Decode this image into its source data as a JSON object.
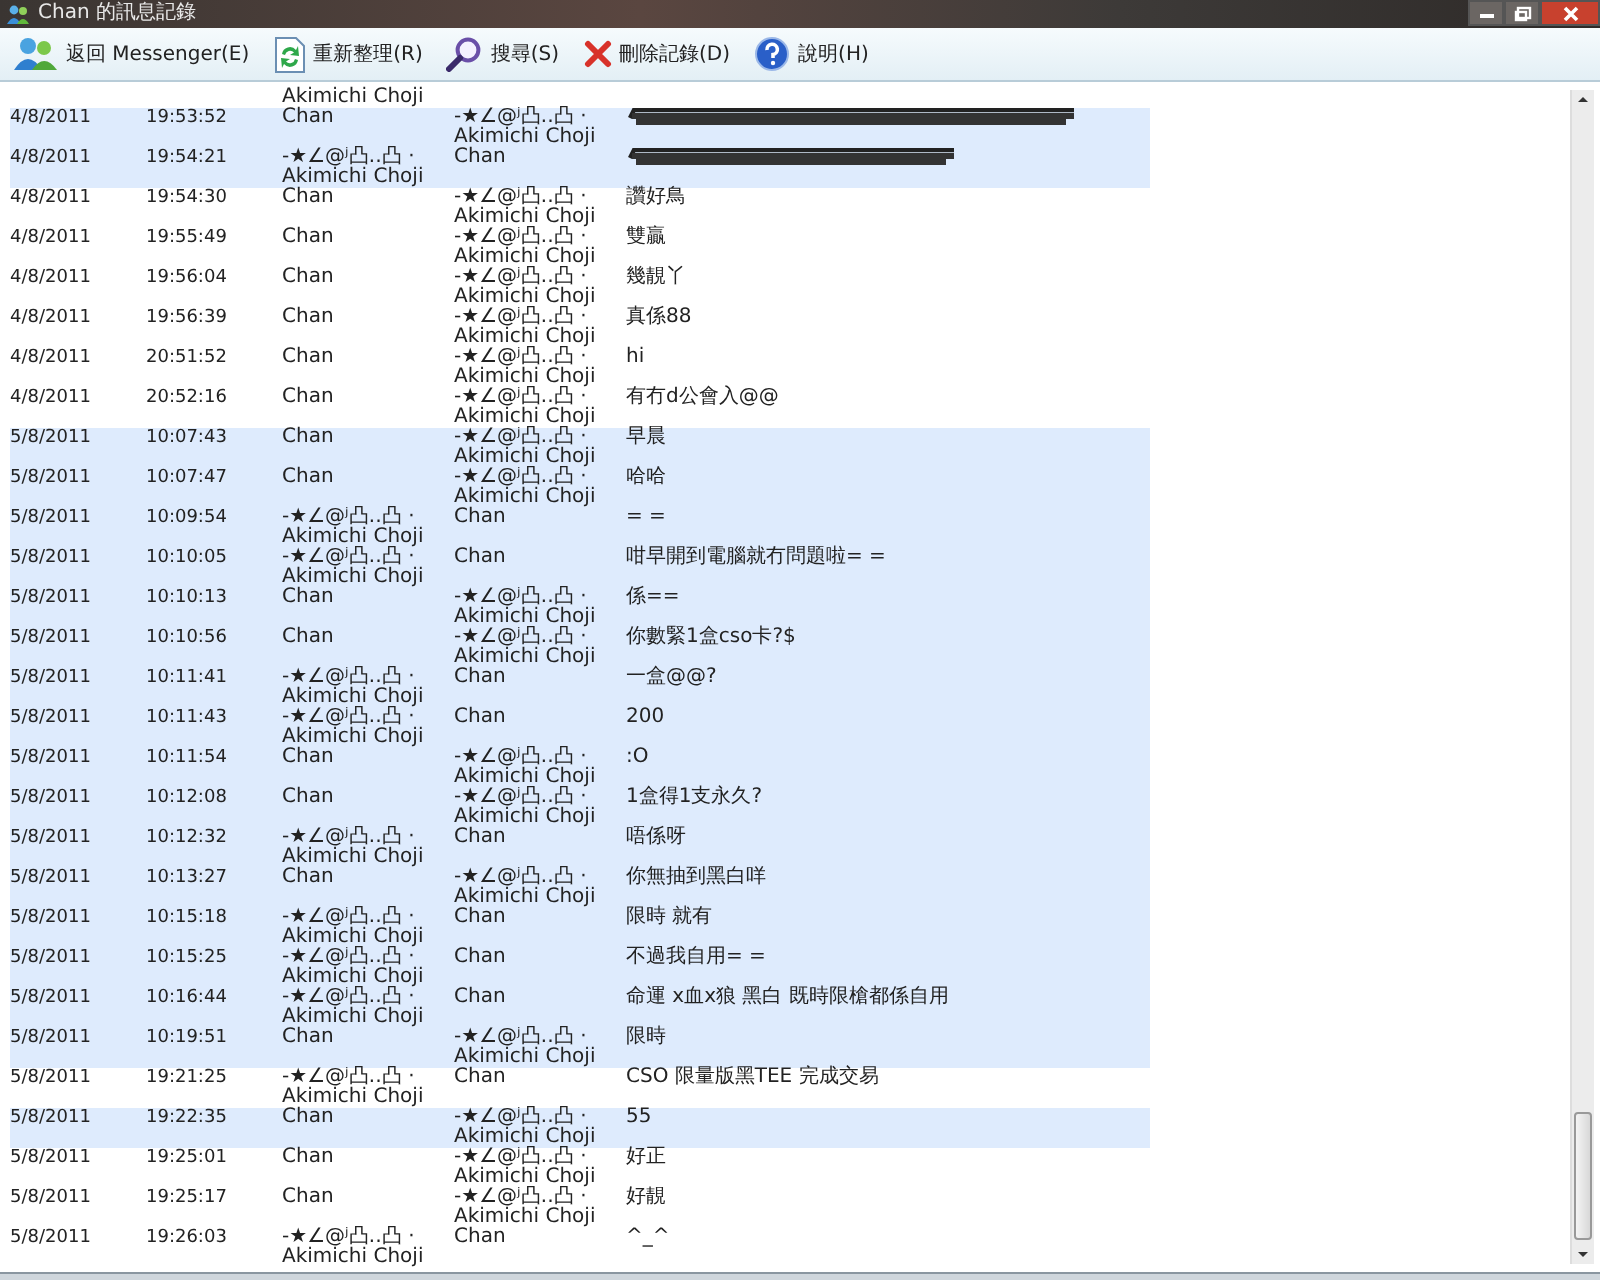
{
  "window": {
    "title": "Chan 的訊息記錄"
  },
  "toolbar": [
    {
      "label": "返回 Messenger(E)"
    },
    {
      "label": "重新整理(R)"
    },
    {
      "label": "搜尋(S)"
    },
    {
      "label": "刪除記錄(D)"
    },
    {
      "label": "說明(H)"
    }
  ],
  "rows": [
    {
      "kind": "continuation",
      "from": "Akimichi Choji",
      "selected": false
    },
    {
      "kind": "redacted",
      "date": "4/8/2011",
      "time": "19:53:52",
      "from": "Chan",
      "to": "-★∠@ʲ凸‥凸 ·\nAkimichi Choji",
      "selected": true
    },
    {
      "kind": "redacted",
      "date": "4/8/2011",
      "time": "19:54:21",
      "from": "-★∠@ʲ凸‥凸 ·\nAkimichi Choji",
      "to": "Chan",
      "selected": true
    },
    {
      "kind": "message",
      "date": "4/8/2011",
      "time": "19:54:30",
      "from": "Chan",
      "to": "-★∠@ʲ凸‥凸 ·\nAkimichi Choji",
      "message": "讚好鳥",
      "selected": false
    },
    {
      "kind": "message",
      "date": "4/8/2011",
      "time": "19:55:49",
      "from": "Chan",
      "to": "-★∠@ʲ凸‥凸 ·\nAkimichi Choji",
      "message": "雙贏",
      "selected": false
    },
    {
      "kind": "message",
      "date": "4/8/2011",
      "time": "19:56:04",
      "from": "Chan",
      "to": "-★∠@ʲ凸‥凸 ·\nAkimichi Choji",
      "message": "幾靚丫",
      "selected": false
    },
    {
      "kind": "message",
      "date": "4/8/2011",
      "time": "19:56:39",
      "from": "Chan",
      "to": "-★∠@ʲ凸‥凸 ·\nAkimichi Choji",
      "message": "真係88",
      "selected": false
    },
    {
      "kind": "message",
      "date": "4/8/2011",
      "time": "20:51:52",
      "from": "Chan",
      "to": "-★∠@ʲ凸‥凸 ·\nAkimichi Choji",
      "message": "hi",
      "selected": false
    },
    {
      "kind": "message",
      "date": "4/8/2011",
      "time": "20:52:16",
      "from": "Chan",
      "to": "-★∠@ʲ凸‥凸 ·\nAkimichi Choji",
      "message": "有冇d公會入@@",
      "selected": false
    },
    {
      "kind": "message",
      "date": "5/8/2011",
      "time": "10:07:43",
      "from": "Chan",
      "to": "-★∠@ʲ凸‥凸 ·\nAkimichi Choji",
      "message": "早晨",
      "selected": true
    },
    {
      "kind": "message",
      "date": "5/8/2011",
      "time": "10:07:47",
      "from": "Chan",
      "to": "-★∠@ʲ凸‥凸 ·\nAkimichi Choji",
      "message": "哈哈",
      "selected": true
    },
    {
      "kind": "message",
      "date": "5/8/2011",
      "time": "10:09:54",
      "from": "-★∠@ʲ凸‥凸 ·\nAkimichi Choji",
      "to": "Chan",
      "message": "= =",
      "selected": true
    },
    {
      "kind": "message",
      "date": "5/8/2011",
      "time": "10:10:05",
      "from": "-★∠@ʲ凸‥凸 ·\nAkimichi Choji",
      "to": "Chan",
      "message": "咁早開到電腦就冇問題啦= =",
      "selected": true
    },
    {
      "kind": "message",
      "date": "5/8/2011",
      "time": "10:10:13",
      "from": "Chan",
      "to": "-★∠@ʲ凸‥凸 ·\nAkimichi Choji",
      "message": "係==",
      "selected": true
    },
    {
      "kind": "message",
      "date": "5/8/2011",
      "time": "10:10:56",
      "from": "Chan",
      "to": "-★∠@ʲ凸‥凸 ·\nAkimichi Choji",
      "message": "你數緊1盒cso卡?$",
      "selected": true
    },
    {
      "kind": "message",
      "date": "5/8/2011",
      "time": "10:11:41",
      "from": "-★∠@ʲ凸‥凸 ·\nAkimichi Choji",
      "to": "Chan",
      "message": "一盒@@?",
      "selected": true
    },
    {
      "kind": "message",
      "date": "5/8/2011",
      "time": "10:11:43",
      "from": "-★∠@ʲ凸‥凸 ·\nAkimichi Choji",
      "to": "Chan",
      "message": "200",
      "selected": true
    },
    {
      "kind": "message",
      "date": "5/8/2011",
      "time": "10:11:54",
      "from": "Chan",
      "to": "-★∠@ʲ凸‥凸 ·\nAkimichi Choji",
      "message": ":O",
      "selected": true
    },
    {
      "kind": "message",
      "date": "5/8/2011",
      "time": "10:12:08",
      "from": "Chan",
      "to": "-★∠@ʲ凸‥凸 ·\nAkimichi Choji",
      "message": "1盒得1支永久?",
      "selected": true
    },
    {
      "kind": "message",
      "date": "5/8/2011",
      "time": "10:12:32",
      "from": "-★∠@ʲ凸‥凸 ·\nAkimichi Choji",
      "to": "Chan",
      "message": "唔係呀",
      "selected": true
    },
    {
      "kind": "message",
      "date": "5/8/2011",
      "time": "10:13:27",
      "from": "Chan",
      "to": "-★∠@ʲ凸‥凸 ·\nAkimichi Choji",
      "message": "你無抽到黑白咩",
      "selected": true
    },
    {
      "kind": "message",
      "date": "5/8/2011",
      "time": "10:15:18",
      "from": "-★∠@ʲ凸‥凸 ·\nAkimichi Choji",
      "to": "Chan",
      "message": "限時 就有",
      "selected": true
    },
    {
      "kind": "message",
      "date": "5/8/2011",
      "time": "10:15:25",
      "from": "-★∠@ʲ凸‥凸 ·\nAkimichi Choji",
      "to": "Chan",
      "message": "不過我自用= =",
      "selected": true
    },
    {
      "kind": "message",
      "date": "5/8/2011",
      "time": "10:16:44",
      "from": "-★∠@ʲ凸‥凸 ·\nAkimichi Choji",
      "to": "Chan",
      "message": "命運 x血x狼 黑白 既時限槍都係自用",
      "selected": true
    },
    {
      "kind": "message",
      "date": "5/8/2011",
      "time": "10:19:51",
      "from": "Chan",
      "to": "-★∠@ʲ凸‥凸 ·\nAkimichi Choji",
      "message": "限時",
      "selected": true
    },
    {
      "kind": "message",
      "date": "5/8/2011",
      "time": "19:21:25",
      "from": "-★∠@ʲ凸‥凸 ·\nAkimichi Choji",
      "to": "Chan",
      "message": "CSO 限量版黑TEE 完成交易",
      "selected": false
    },
    {
      "kind": "message",
      "date": "5/8/2011",
      "time": "19:22:35",
      "from": "Chan",
      "to": "-★∠@ʲ凸‥凸 ·\nAkimichi Choji",
      "message": "55",
      "selected": true
    },
    {
      "kind": "message",
      "date": "5/8/2011",
      "time": "19:25:01",
      "from": "Chan",
      "to": "-★∠@ʲ凸‥凸 ·\nAkimichi Choji",
      "message": "好正",
      "selected": false
    },
    {
      "kind": "message",
      "date": "5/8/2011",
      "time": "19:25:17",
      "from": "Chan",
      "to": "-★∠@ʲ凸‥凸 ·\nAkimichi Choji",
      "message": "好靚",
      "selected": false
    },
    {
      "kind": "message",
      "date": "5/8/2011",
      "time": "19:26:03",
      "from": "-★∠@ʲ凸‥凸 ·\nAkimichi Choji",
      "to": "Chan",
      "message": "^_^",
      "selected": false
    }
  ]
}
